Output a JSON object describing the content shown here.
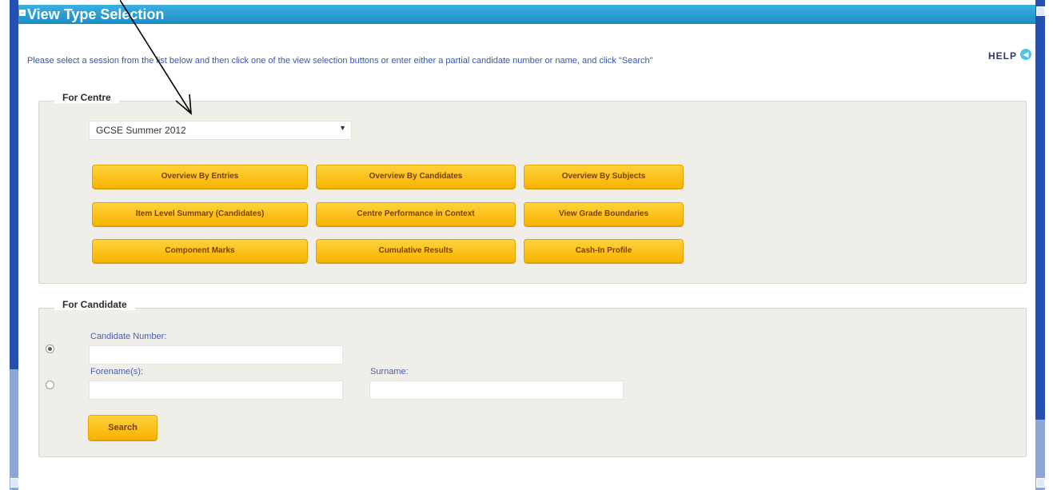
{
  "window": {
    "title": "View Type Selection",
    "collapse_glyph": "−"
  },
  "intro": {
    "instructions": "Please select a session from the list below and then click one of the view selection buttons or enter either a partial candidate number or name, and click \"Search\"",
    "help_label": "HELP",
    "help_icon": "speaker-icon",
    "help_glyph": "◀"
  },
  "centre_section": {
    "legend": "For Centre",
    "session": {
      "selected": "GCSE Summer 2012",
      "arrow": "▼"
    },
    "buttons": [
      [
        "Overview By Entries",
        "Overview By Candidates",
        "Overview By Subjects"
      ],
      [
        "Item Level Summary (Candidates)",
        "Centre Performance in Context",
        "View Grade Boundaries"
      ],
      [
        "Component Marks",
        "Cumulative Results",
        "Cash-In Profile"
      ]
    ]
  },
  "candidate_section": {
    "legend": "For Candidate",
    "candidate_number_label": "Candidate Number:",
    "candidate_number_value": "",
    "forename_label": "Forename(s):",
    "forename_value": "",
    "surname_label": "Surname:",
    "surname_value": "",
    "search_label": "Search",
    "selected_option": "candidate-number"
  },
  "colors": {
    "title_bar": "#1c8cc6",
    "button": "#f7b400",
    "panel": "#efeee9",
    "window_frame": "#2450b0"
  }
}
